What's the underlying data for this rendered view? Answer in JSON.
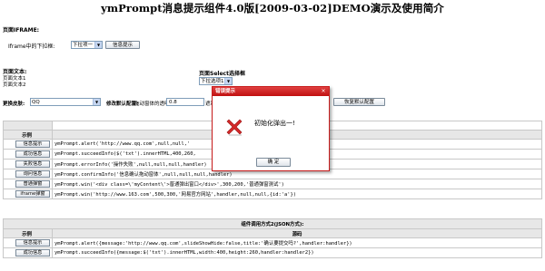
{
  "title": "ymPrompt消息提示组件4.0版[2009-03-02]DEMO演示及使用简介",
  "iframe_section": {
    "heading": "页面IFRAME:",
    "label": "Iframe中的下拉框:",
    "select_value": "下拉项一",
    "button": "信息提示"
  },
  "text_section": {
    "heading": "页面文本:",
    "line1": "页面文本1",
    "line2": "页面文本2"
  },
  "select_section": {
    "heading": "页面Select选择框",
    "select_value": "下拉选项1"
  },
  "toolbar": {
    "skin_label": "更换皮肤:",
    "skin_value": "QQ",
    "config_label": "修改默认配置:",
    "opacity_label": "拖动窗体的透明度:",
    "opacity_value": "0.8",
    "extra_label": "遮罩",
    "restore_button": "恢复默认配置"
  },
  "table1": {
    "header_right": "示例",
    "rows": [
      {
        "button": "信息提示",
        "code": "ymPrompt.alert('http://www.qq.com',null,null,'"
      },
      {
        "button": "成功信息",
        "code": "ymPrompt.succeedInfo($('txt').innerHTML,400,260,"
      },
      {
        "button": "失败信息",
        "code": "ymPrompt.errorInfo('操作失败',null,null,null,handler)"
      },
      {
        "button": "询问信息",
        "code": "ymPrompt.confirmInfo('信息确认拖动窗体',null,null,null,handler)"
      },
      {
        "button": "普通弹窗",
        "code": "ymPrompt.win('<div class=\\'myContent\\'>普通弹出窗口</div>',300,200,'普通弹窗测试')"
      },
      {
        "button": "iframe弹窗",
        "code": "ymPrompt.win('http://www.163.com',500,300,'网易官方网站',handler,null,null,{id:'a'})"
      }
    ]
  },
  "table2": {
    "section_title": "组件调用方式2(JSON方式):",
    "col1": "示例",
    "col2": "源码",
    "rows": [
      {
        "button": "信息提示",
        "code": "ymPrompt.alert({message:'http://www.qq.com',slideShowHide:false,title:'确认要提交吗?',handler:handler})"
      },
      {
        "button": "成功信息",
        "code": "ymPrompt.succeedInfo({message:$('txt').innerHTML,width:400,height:260,handler:handler2})"
      }
    ]
  },
  "dialog": {
    "title": "错误提示",
    "message": "初始化弹出一!",
    "ok": "确 定",
    "close": "×",
    "icon": "error-x-icon"
  },
  "colors": {
    "dialog_border": "#c71b1b",
    "error_icon": "#d42a2a"
  }
}
